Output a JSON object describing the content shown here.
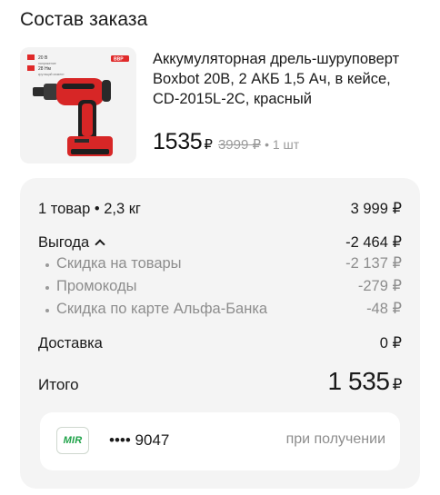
{
  "header": {
    "title": "Состав заказа"
  },
  "product": {
    "name": "Аккумуляторная дрель-шуруповерт Boxbot 20В, 2 АКБ 1,5 Ач, в кейсе, CD-2015L-2C, красный",
    "price_now": "1535",
    "currency": "₽",
    "price_old": "3999",
    "quantity": "• 1 шт",
    "image_badge": "20 В",
    "image_badge_sub": "напряжение",
    "image_badge2": "28 Нм",
    "image_badge2_sub": "крутящий момент",
    "image_brand": "BBP"
  },
  "summary": {
    "items_label": "1 товар • 2,3 кг",
    "items_value": "3 999 ₽",
    "benefit_label": "Выгода",
    "benefit_value": "-2 464 ₽",
    "discounts": [
      {
        "label": "Скидка на товары",
        "value": "-2 137 ₽"
      },
      {
        "label": "Промокоды",
        "value": "-279 ₽"
      },
      {
        "label": "Скидка по карте Альфа-Банка",
        "value": "-48 ₽"
      }
    ],
    "delivery_label": "Доставка",
    "delivery_value": "0 ₽",
    "total_label": "Итого",
    "total_value": "1 535",
    "total_currency": "₽"
  },
  "payment": {
    "card_brand": "MIR",
    "card_number": "•••• 9047",
    "when": "при получении"
  },
  "colors": {
    "mir_green": "#1ea248",
    "panel_bg": "#f4f4f4",
    "muted_text": "#8d8d8d"
  }
}
